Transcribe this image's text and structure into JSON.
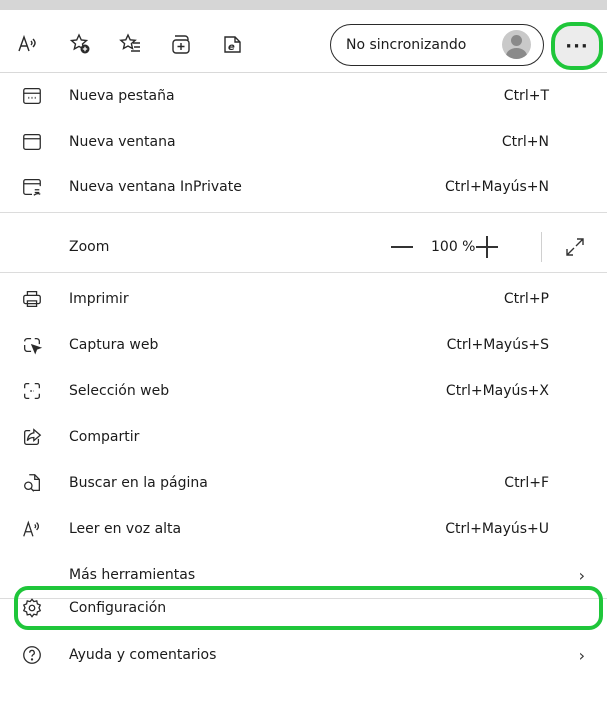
{
  "toolbar": {
    "sync_label": "No sincronizando",
    "more_label": "···",
    "icons": [
      "read-aloud-icon",
      "add-favorite-icon",
      "favorites-icon",
      "collections-icon",
      "ie-mode-icon"
    ]
  },
  "menu": {
    "new_tab": {
      "label": "Nueva pestaña",
      "shortcut": "Ctrl+T"
    },
    "new_window": {
      "label": "Nueva ventana",
      "shortcut": "Ctrl+N"
    },
    "new_inprivate": {
      "label": "Nueva ventana InPrivate",
      "shortcut": "Ctrl+Mayús+N"
    },
    "zoom": {
      "label": "Zoom",
      "value": "100 %"
    },
    "print": {
      "label": "Imprimir",
      "shortcut": "Ctrl+P"
    },
    "web_capture": {
      "label": "Captura web",
      "shortcut": "Ctrl+Mayús+S"
    },
    "web_select": {
      "label": "Selección web",
      "shortcut": "Ctrl+Mayús+X"
    },
    "share": {
      "label": "Compartir"
    },
    "find": {
      "label": "Buscar en la página",
      "shortcut": "Ctrl+F"
    },
    "read_aloud": {
      "label": "Leer en voz alta",
      "shortcut": "Ctrl+Mayús+U"
    },
    "more_tools": {
      "label": "Más herramientas"
    },
    "settings": {
      "label": "Configuración"
    },
    "help": {
      "label": "Ayuda y comentarios"
    }
  },
  "colors": {
    "highlight": "#1fc63a"
  }
}
